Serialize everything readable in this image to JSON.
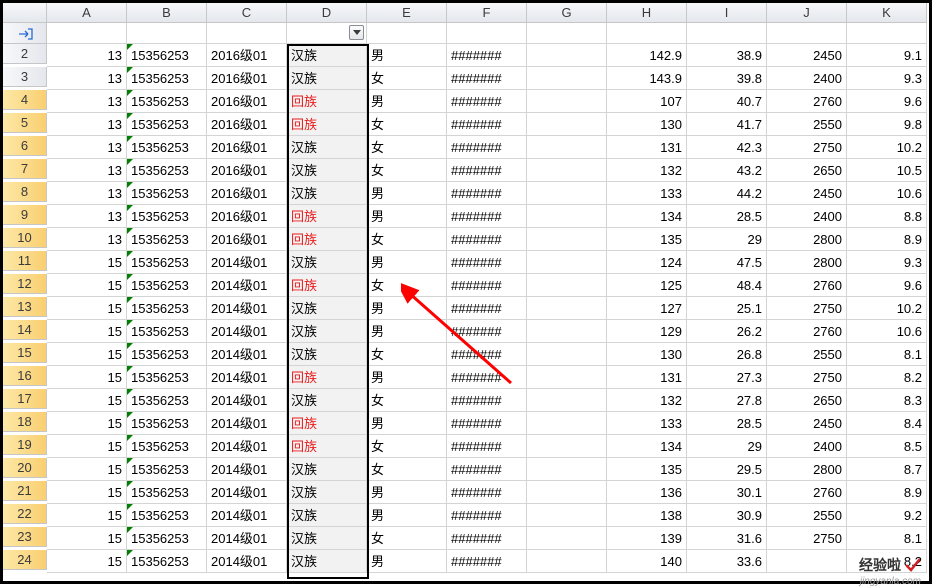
{
  "columns": [
    "A",
    "B",
    "C",
    "D",
    "E",
    "F",
    "G",
    "H",
    "I",
    "J",
    "K"
  ],
  "filter_col_index": 3,
  "rows": [
    {
      "n": 2,
      "sel": false,
      "A": "13",
      "B": "15356253",
      "C": "2016级01",
      "D": "汉族",
      "Dred": false,
      "E": "男",
      "F": "#######",
      "G": "",
      "H": "142.9",
      "I": "38.9",
      "J": "2450",
      "K": "9.1"
    },
    {
      "n": 3,
      "sel": false,
      "A": "13",
      "B": "15356253",
      "C": "2016级01",
      "D": "汉族",
      "Dred": false,
      "E": "女",
      "F": "#######",
      "G": "",
      "H": "143.9",
      "I": "39.8",
      "J": "2400",
      "K": "9.3"
    },
    {
      "n": 4,
      "sel": true,
      "A": "13",
      "B": "15356253",
      "C": "2016级01",
      "D": "回族",
      "Dred": true,
      "E": "男",
      "F": "#######",
      "G": "",
      "H": "107",
      "I": "40.7",
      "J": "2760",
      "K": "9.6"
    },
    {
      "n": 5,
      "sel": true,
      "A": "13",
      "B": "15356253",
      "C": "2016级01",
      "D": "回族",
      "Dred": true,
      "E": "女",
      "F": "#######",
      "G": "",
      "H": "130",
      "I": "41.7",
      "J": "2550",
      "K": "9.8"
    },
    {
      "n": 6,
      "sel": true,
      "A": "13",
      "B": "15356253",
      "C": "2016级01",
      "D": "汉族",
      "Dred": false,
      "E": "女",
      "F": "#######",
      "G": "",
      "H": "131",
      "I": "42.3",
      "J": "2750",
      "K": "10.2"
    },
    {
      "n": 7,
      "sel": true,
      "A": "13",
      "B": "15356253",
      "C": "2016级01",
      "D": "汉族",
      "Dred": false,
      "E": "女",
      "F": "#######",
      "G": "",
      "H": "132",
      "I": "43.2",
      "J": "2650",
      "K": "10.5"
    },
    {
      "n": 8,
      "sel": true,
      "A": "13",
      "B": "15356253",
      "C": "2016级01",
      "D": "汉族",
      "Dred": false,
      "E": "男",
      "F": "#######",
      "G": "",
      "H": "133",
      "I": "44.2",
      "J": "2450",
      "K": "10.6"
    },
    {
      "n": 9,
      "sel": true,
      "A": "13",
      "B": "15356253",
      "C": "2016级01",
      "D": "回族",
      "Dred": true,
      "E": "男",
      "F": "#######",
      "G": "",
      "H": "134",
      "I": "28.5",
      "J": "2400",
      "K": "8.8"
    },
    {
      "n": 10,
      "sel": true,
      "A": "13",
      "B": "15356253",
      "C": "2016级01",
      "D": "回族",
      "Dred": true,
      "E": "女",
      "F": "#######",
      "G": "",
      "H": "135",
      "I": "29",
      "J": "2800",
      "K": "8.9"
    },
    {
      "n": 11,
      "sel": true,
      "A": "15",
      "B": "15356253",
      "C": "2014级01",
      "D": "汉族",
      "Dred": false,
      "E": "男",
      "F": "#######",
      "G": "",
      "H": "124",
      "I": "47.5",
      "J": "2800",
      "K": "9.3"
    },
    {
      "n": 12,
      "sel": true,
      "A": "15",
      "B": "15356253",
      "C": "2014级01",
      "D": "回族",
      "Dred": true,
      "E": "女",
      "F": "#######",
      "G": "",
      "H": "125",
      "I": "48.4",
      "J": "2760",
      "K": "9.6"
    },
    {
      "n": 13,
      "sel": true,
      "A": "15",
      "B": "15356253",
      "C": "2014级01",
      "D": "汉族",
      "Dred": false,
      "E": "男",
      "F": "#######",
      "G": "",
      "H": "127",
      "I": "25.1",
      "J": "2750",
      "K": "10.2"
    },
    {
      "n": 14,
      "sel": true,
      "A": "15",
      "B": "15356253",
      "C": "2014级01",
      "D": "汉族",
      "Dred": false,
      "E": "男",
      "F": "#######",
      "G": "",
      "H": "129",
      "I": "26.2",
      "J": "2760",
      "K": "10.6"
    },
    {
      "n": 15,
      "sel": true,
      "A": "15",
      "B": "15356253",
      "C": "2014级01",
      "D": "汉族",
      "Dred": false,
      "E": "女",
      "F": "#######",
      "G": "",
      "H": "130",
      "I": "26.8",
      "J": "2550",
      "K": "8.1"
    },
    {
      "n": 16,
      "sel": true,
      "A": "15",
      "B": "15356253",
      "C": "2014级01",
      "D": "回族",
      "Dred": true,
      "E": "男",
      "F": "#######",
      "G": "",
      "H": "131",
      "I": "27.3",
      "J": "2750",
      "K": "8.2"
    },
    {
      "n": 17,
      "sel": true,
      "A": "15",
      "B": "15356253",
      "C": "2014级01",
      "D": "汉族",
      "Dred": false,
      "E": "女",
      "F": "#######",
      "G": "",
      "H": "132",
      "I": "27.8",
      "J": "2650",
      "K": "8.3"
    },
    {
      "n": 18,
      "sel": true,
      "A": "15",
      "B": "15356253",
      "C": "2014级01",
      "D": "回族",
      "Dred": true,
      "E": "男",
      "F": "#######",
      "G": "",
      "H": "133",
      "I": "28.5",
      "J": "2450",
      "K": "8.4"
    },
    {
      "n": 19,
      "sel": true,
      "A": "15",
      "B": "15356253",
      "C": "2014级01",
      "D": "回族",
      "Dred": true,
      "E": "女",
      "F": "#######",
      "G": "",
      "H": "134",
      "I": "29",
      "J": "2400",
      "K": "8.5"
    },
    {
      "n": 20,
      "sel": true,
      "A": "15",
      "B": "15356253",
      "C": "2014级01",
      "D": "汉族",
      "Dred": false,
      "E": "女",
      "F": "#######",
      "G": "",
      "H": "135",
      "I": "29.5",
      "J": "2800",
      "K": "8.7"
    },
    {
      "n": 21,
      "sel": true,
      "A": "15",
      "B": "15356253",
      "C": "2014级01",
      "D": "汉族",
      "Dred": false,
      "E": "男",
      "F": "#######",
      "G": "",
      "H": "136",
      "I": "30.1",
      "J": "2760",
      "K": "8.9"
    },
    {
      "n": 22,
      "sel": true,
      "A": "15",
      "B": "15356253",
      "C": "2014级01",
      "D": "汉族",
      "Dred": false,
      "E": "男",
      "F": "#######",
      "G": "",
      "H": "138",
      "I": "30.9",
      "J": "2550",
      "K": "9.2"
    },
    {
      "n": 23,
      "sel": true,
      "A": "15",
      "B": "15356253",
      "C": "2014级01",
      "D": "汉族",
      "Dred": false,
      "E": "女",
      "F": "#######",
      "G": "",
      "H": "139",
      "I": "31.6",
      "J": "2750",
      "K": "8.1"
    },
    {
      "n": 24,
      "sel": true,
      "A": "15",
      "B": "15356253",
      "C": "2014级01",
      "D": "汉族",
      "Dred": false,
      "E": "男",
      "F": "#######",
      "G": "",
      "H": "140",
      "I": "33.6",
      "J": "",
      "K": "8.2"
    }
  ],
  "watermark_text_a": "经验啦",
  "watermark_text_b": "jingyanla.com"
}
